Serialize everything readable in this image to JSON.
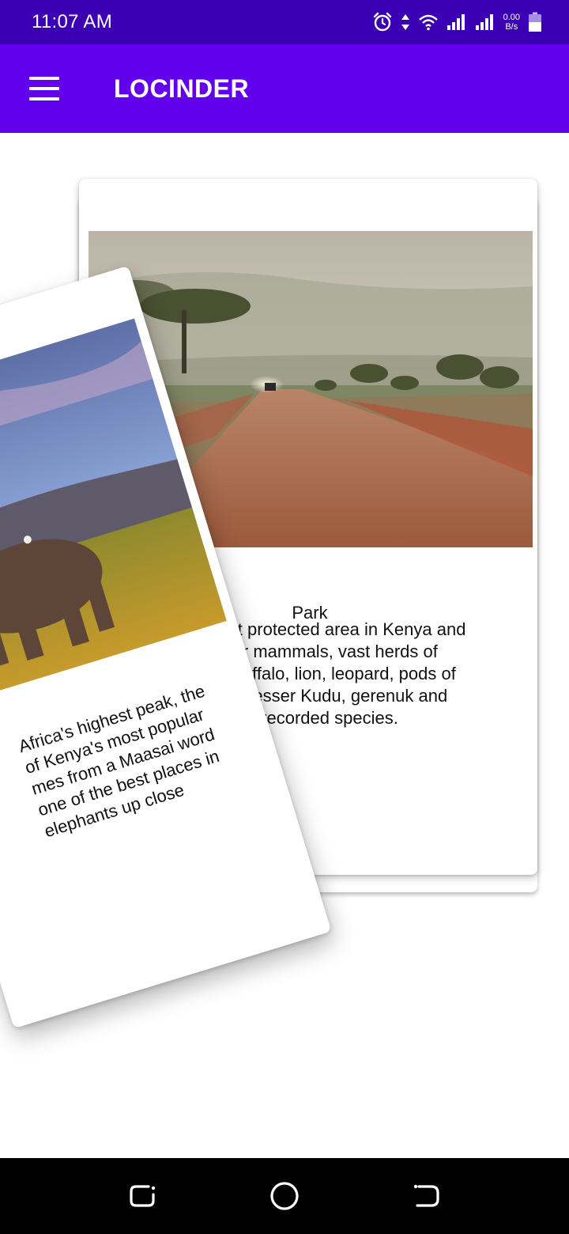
{
  "status_bar": {
    "time": "11:07 AM",
    "net_speed_value": "0.00",
    "net_speed_unit": "B/s",
    "icons": [
      "alarm-icon",
      "data-arrows-icon",
      "wifi-icon",
      "signal-icon",
      "signal-icon",
      "battery-icon"
    ]
  },
  "app_bar": {
    "title": "LOCINDER",
    "menu_icon": "hamburger-menu-icon",
    "color": "#6200ee"
  },
  "cards": {
    "back": {
      "image": "dirt-road-savanna-photo",
      "title": "Park",
      "description": "rgest protected area in Kenya and\n larger mammals, vast herds of\nno, buffalo, lion, leopard, pods of\nucks, lesser Kudu, gerenuk and\nes 500 recorded species."
    },
    "front": {
      "image": "elephant-savanna-photo",
      "title": "",
      "description": "Africa's highest peak, the\nof Kenya's most popular\nmes from a Maasai word\none of the best places in\nelephants up close"
    }
  },
  "nav_bar": {
    "icons": [
      "recent-apps-icon",
      "home-icon",
      "back-icon"
    ]
  },
  "colors": {
    "status_bar": "#3b00b3",
    "app_bar": "#6200ee",
    "nav_bar": "#000000"
  }
}
